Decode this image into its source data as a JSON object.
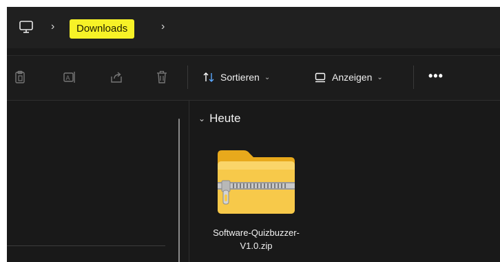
{
  "address_bar": {
    "root_icon": "monitor-icon",
    "separator": "›",
    "breadcrumb": [
      "Downloads"
    ],
    "highlight_color": "#f7f227"
  },
  "toolbar": {
    "icons": [
      "clipboard-icon",
      "rename-icon",
      "share-icon",
      "trash-icon"
    ],
    "sort": {
      "label": "Sortieren",
      "icon": "sort-arrows-icon"
    },
    "view": {
      "label": "Anzeigen",
      "icon": "view-icon"
    },
    "more": "•••"
  },
  "content": {
    "group_header": "Heute",
    "files": [
      {
        "name": "Software-Quizbuzzer-V1.0.zip",
        "icon": "zip-folder-icon"
      }
    ]
  },
  "colors": {
    "background": "#191919",
    "folder_yellow": "#f5c53a"
  }
}
